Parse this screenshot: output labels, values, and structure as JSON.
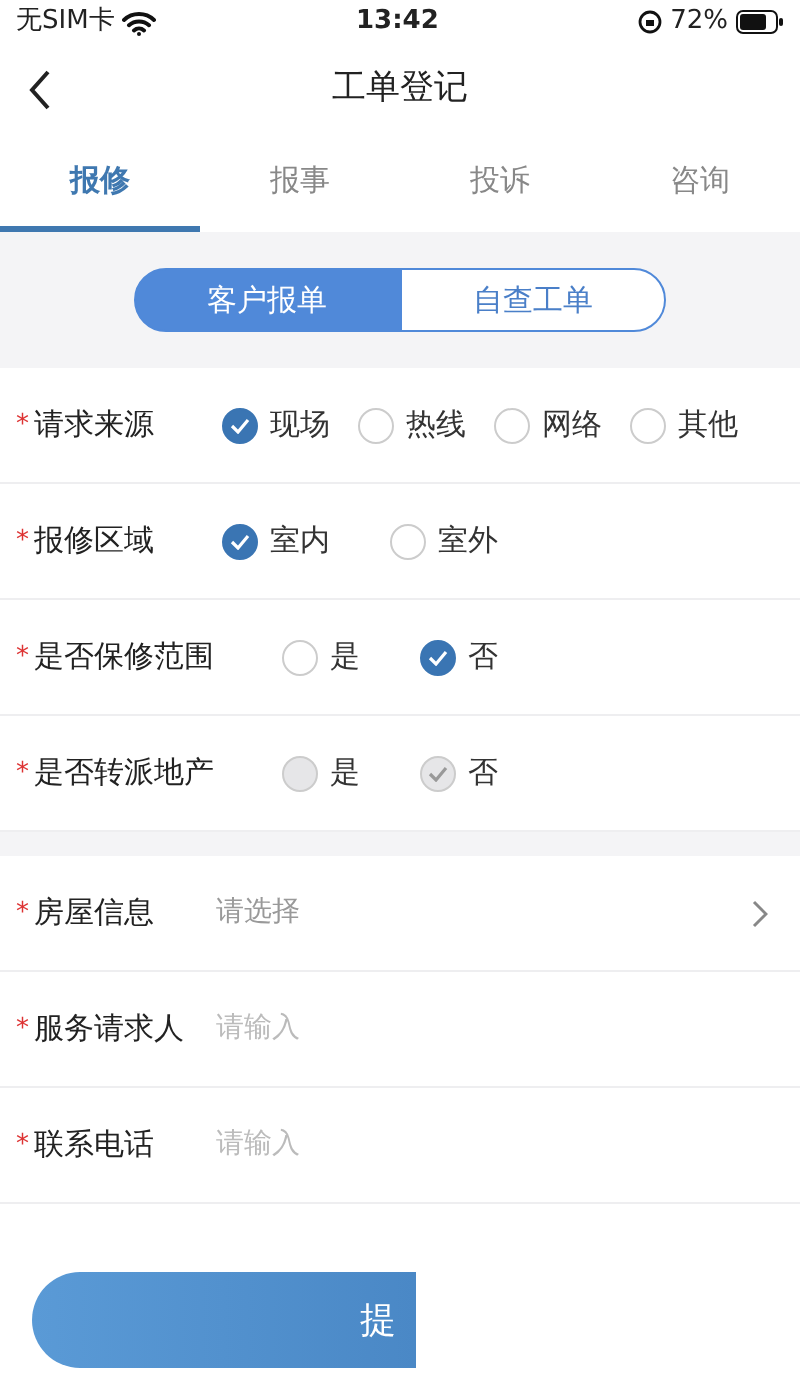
{
  "status_bar": {
    "carrier": "无SIM卡",
    "time": "13:42",
    "battery": "72%"
  },
  "header": {
    "title": "工单登记"
  },
  "tabs": [
    {
      "label": "报修",
      "selected": true
    },
    {
      "label": "报事",
      "selected": false
    },
    {
      "label": "投诉",
      "selected": false
    },
    {
      "label": "咨询",
      "selected": false
    }
  ],
  "segments": [
    {
      "label": "客户报单",
      "selected": true
    },
    {
      "label": "自查工单",
      "selected": false
    }
  ],
  "choice_rows": [
    {
      "label": "请求来源",
      "marker": "*",
      "options": [
        {
          "label": "现场",
          "selected": true,
          "disabled": false
        },
        {
          "label": "热线",
          "selected": false,
          "disabled": false
        },
        {
          "label": "网络",
          "selected": false,
          "disabled": false
        },
        {
          "label": "其他",
          "selected": false,
          "disabled": false
        }
      ]
    },
    {
      "label": "报修区域",
      "marker": "*",
      "options": [
        {
          "label": "室内",
          "selected": true,
          "disabled": false
        },
        {
          "label": "室外",
          "selected": false,
          "disabled": false
        }
      ]
    },
    {
      "label": "是否保修范围",
      "marker": "*",
      "options": [
        {
          "label": "是",
          "selected": false,
          "disabled": false
        },
        {
          "label": "否",
          "selected": true,
          "disabled": false
        }
      ]
    },
    {
      "label": "是否转派地产",
      "marker": "*",
      "options": [
        {
          "label": "是",
          "selected": false,
          "disabled": true
        },
        {
          "label": "否",
          "selected": true,
          "disabled": true
        }
      ]
    }
  ],
  "field_rows": [
    {
      "kind": "select",
      "label": "房屋信息",
      "marker": "*",
      "placeholder": "请选择"
    },
    {
      "kind": "input",
      "label": "服务请求人",
      "marker": "*",
      "placeholder": "请输入"
    },
    {
      "kind": "input",
      "label": "联系电话",
      "marker": "*",
      "placeholder": "请输入"
    }
  ],
  "submit_button": {
    "label": "提"
  }
}
